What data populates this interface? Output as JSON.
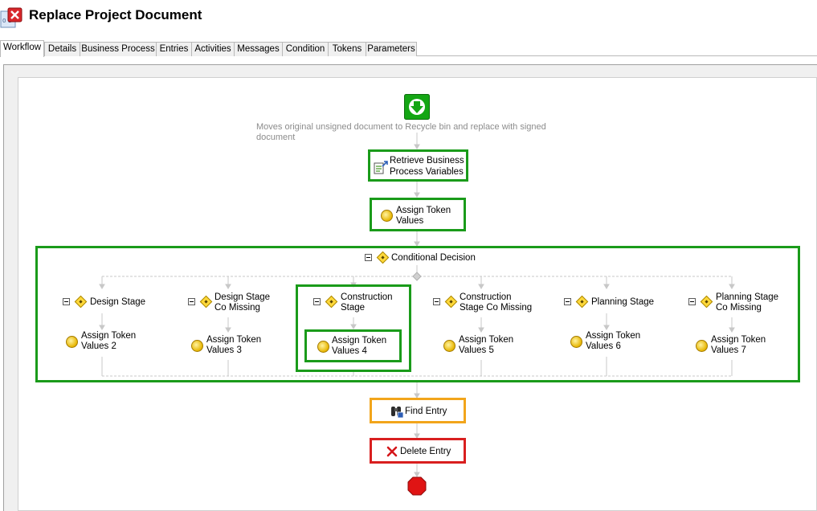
{
  "window": {
    "title": "Replace Project Document"
  },
  "tabs": [
    {
      "label": "Workflow",
      "active": true
    },
    {
      "label": "Details"
    },
    {
      "label": "Business Process"
    },
    {
      "label": "Entries"
    },
    {
      "label": "Activities"
    },
    {
      "label": "Messages"
    },
    {
      "label": "Condition"
    },
    {
      "label": "Tokens"
    },
    {
      "label": "Parameters"
    }
  ],
  "workflow": {
    "start_icon": "start-arrow-icon",
    "description": "Moves original unsigned document to Recycle bin and replace with signed document",
    "retrieve": {
      "line1": "Retrieve Business",
      "line2": "Process Variables"
    },
    "assign": {
      "line1": "Assign Token",
      "line2": "Values"
    },
    "conditional": {
      "label": "Conditional Decision"
    },
    "branches": [
      {
        "line1": "Design Stage",
        "line2": "",
        "act1": "Assign Token",
        "act2": "Values 2"
      },
      {
        "line1": "Design Stage",
        "line2": "Co Missing",
        "act1": "Assign Token",
        "act2": "Values 3"
      },
      {
        "line1": "Construction",
        "line2": "Stage",
        "act1": "Assign Token",
        "act2": "Values 4"
      },
      {
        "line1": "Construction",
        "line2": "Stage Co Missing",
        "act1": "Assign Token",
        "act2": "Values 5"
      },
      {
        "line1": "Planning Stage",
        "line2": "",
        "act1": "Assign Token",
        "act2": "Values 6"
      },
      {
        "line1": "Planning Stage",
        "line2": "Co Missing",
        "act1": "Assign Token",
        "act2": "Values 7"
      }
    ],
    "find": {
      "label": "Find Entry"
    },
    "delete": {
      "label": "Delete Entry"
    },
    "end_icon": "stop-icon"
  },
  "colors": {
    "active_green": "#1a9b1a",
    "find_orange": "#f2a51b",
    "delete_red": "#d91f1f"
  }
}
